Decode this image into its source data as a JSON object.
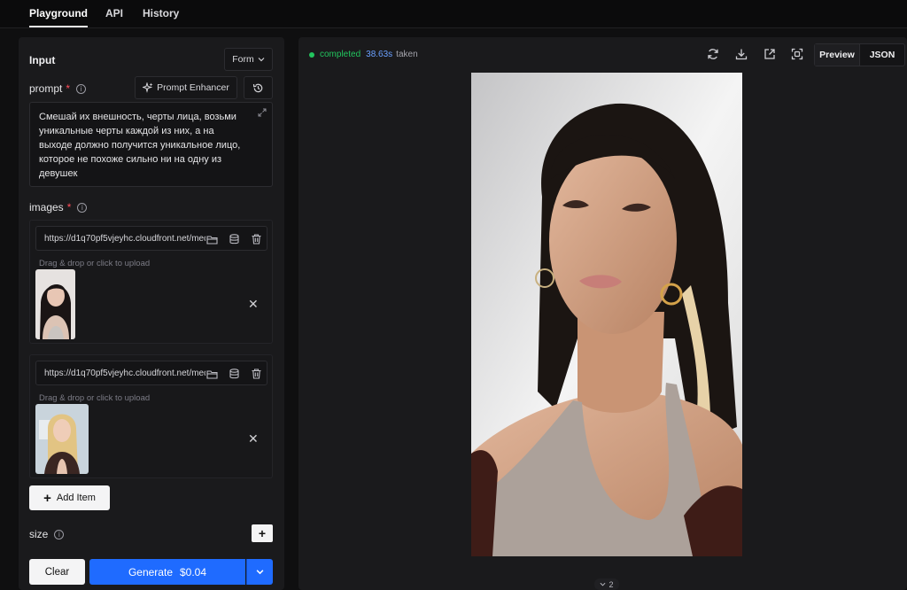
{
  "nav": {
    "tabs": [
      "Playground",
      "API",
      "History"
    ],
    "active": "Playground"
  },
  "input_panel": {
    "title": "Input",
    "mode_select": {
      "value": "Form",
      "icon": "chevron-down-icon"
    },
    "prompt": {
      "label": "prompt",
      "required_mark": "*",
      "enhancer_label": "Prompt Enhancer",
      "value": "Смешай их внешность, черты лица, возьми уникальные черты каждой из них, а на выходе должно получится уникальное лицо, которое не похоже сильно ни на одну из девушек"
    },
    "images": {
      "label": "images",
      "required_mark": "*",
      "items": [
        {
          "url": "https://d1q70pf5vjeyhc.cloudfront.net/media/",
          "drop_hint": "Drag & drop or click to upload"
        },
        {
          "url": "https://d1q70pf5vjeyhc.cloudfront.net/media/",
          "drop_hint": "Drag & drop or click to upload"
        }
      ],
      "add_item_label": "Add Item"
    },
    "size": {
      "label": "size"
    },
    "actions": {
      "clear_label": "Clear",
      "generate_label": "Generate",
      "price": "$0.04"
    }
  },
  "output_panel": {
    "status": "completed",
    "time": "38.63s",
    "time_suffix": "taken",
    "view_tabs": [
      "Preview",
      "JSON"
    ],
    "active_view": "Preview",
    "pager": "2",
    "colors": {
      "status": "#22c55e",
      "time": "#6aa0ff",
      "accent": "#1f6bff"
    }
  }
}
